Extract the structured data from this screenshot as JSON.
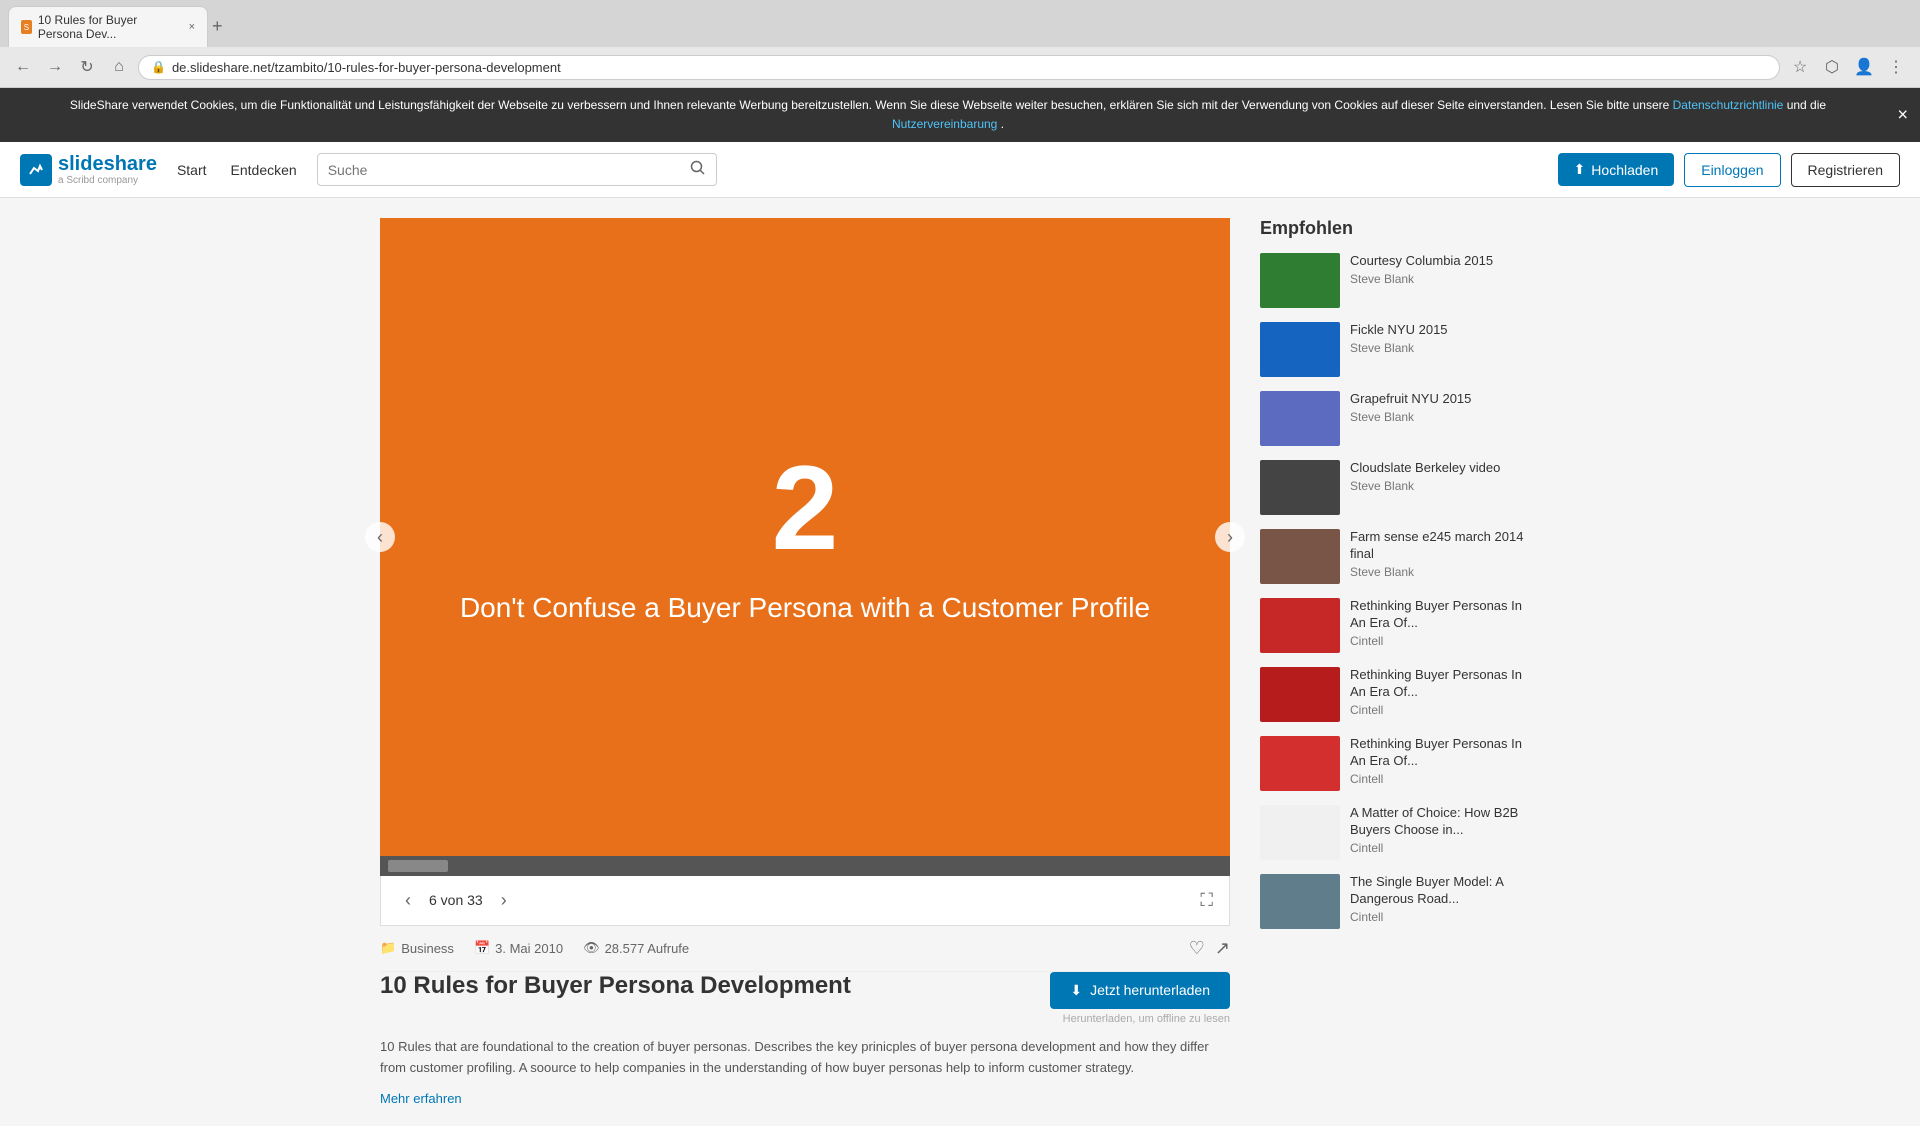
{
  "browser": {
    "tab_title": "10 Rules for Buyer Persona Dev...",
    "tab_close": "×",
    "url": "de.slideshare.net/tzambito/10-rules-for-buyer-persona-development",
    "back": "←",
    "forward": "→",
    "refresh": "↻",
    "home": "⌂"
  },
  "cookie": {
    "text": "SlideShare verwendet Cookies, um die Funktionalität und Leistungsfähigkeit der Webseite zu verbessern und Ihnen relevante Werbung bereitzustellen. Wenn Sie diese Webseite weiter besuchen, erklären Sie sich mit der Verwendung von Cookies auf dieser Seite einverstanden. Lesen Sie bitte unsere ",
    "link1": "Datenschutzrichtlinie",
    "middle": " und die ",
    "link2": "Nutzervereinbarung",
    "end": ".",
    "close": "×"
  },
  "header": {
    "logo_text": "slideshare",
    "logo_sub": "a Scribd company",
    "nav": [
      "Start",
      "Entdecken"
    ],
    "search_placeholder": "Suche",
    "upload_label": "Hochladen",
    "login_label": "Einloggen",
    "register_label": "Registrieren"
  },
  "slide": {
    "number": "2",
    "text": "Don't Confuse a Buyer Persona with a Customer Profile",
    "current": "6",
    "total": "33",
    "counter": "6 von 33"
  },
  "meta": {
    "category": "Business",
    "date": "3. Mai 2010",
    "views": "28.577 Aufrufe"
  },
  "presentation": {
    "title": "10 Rules for Buyer Persona Development",
    "download_label": "Jetzt herunterladen",
    "download_sub": "Herunterladen, um offline zu lesen",
    "description": "10 Rules that are foundational to the creation of buyer personas. Describes the key prinicples of buyer persona development and how they differ from customer profiling. A soource to help companies in the understanding of how buyer personas help to inform customer strategy.",
    "mehr_erfahren": "Mehr erfahren"
  },
  "sidebar": {
    "title": "Empfohlen",
    "items": [
      {
        "title": "Courtesy Columbia 2015",
        "author": "Steve Blank",
        "thumb_type": "green"
      },
      {
        "title": "Fickle NYU 2015",
        "author": "Steve Blank",
        "thumb_type": "blue-doc"
      },
      {
        "title": "Grapefruit NYU 2015",
        "author": "Steve Blank",
        "thumb_type": "person"
      },
      {
        "title": "Cloudslate Berkeley video",
        "author": "Steve Blank",
        "thumb_type": "dark"
      },
      {
        "title": "Farm sense e245 march 2014 final",
        "author": "Steve Blank",
        "thumb_type": "farm"
      },
      {
        "title": "Rethinking Buyer Personas In An Era Of...",
        "author": "Cintell",
        "thumb_type": "red"
      },
      {
        "title": "Rethinking Buyer Personas In An Era Of...",
        "author": "Cintell",
        "thumb_type": "red2"
      },
      {
        "title": "Rethinking Buyer Personas In An Era Of...",
        "author": "Cintell",
        "thumb_type": "red3"
      },
      {
        "title": "A Matter of Choice: How B2B Buyers Choose in...",
        "author": "Cintell",
        "thumb_type": "choice"
      },
      {
        "title": "The Single Buyer Model: A Dangerous Road...",
        "author": "Cintell",
        "thumb_type": "road"
      }
    ]
  }
}
